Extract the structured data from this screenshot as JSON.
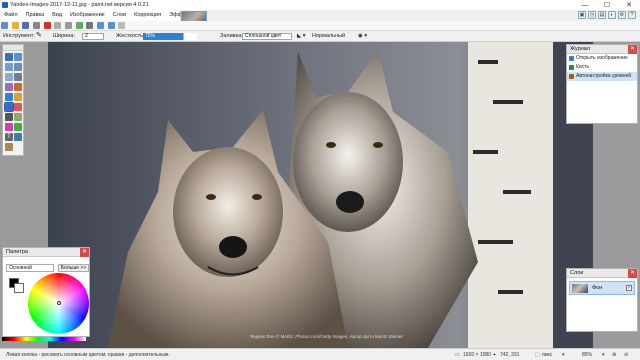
{
  "window": {
    "title": "Yandex-Images-2017-12-11.jpg - paint.net версия 4.0.21",
    "minimize": "—",
    "maximize": "☐",
    "close": "✕"
  },
  "menu": [
    "Файл",
    "Правка",
    "Вид",
    "Изображение",
    "Слои",
    "Коррекция",
    "Эффекты"
  ],
  "toolbar2": {
    "tool_label": "Инструмент:",
    "width_label": "Ширина:",
    "width_value": "2",
    "hardness_label": "Жесткость:",
    "hardness_value": "75%",
    "hardness": 0.75,
    "fill_label": "Заливка:",
    "fill_value": "Сплошной цвет",
    "blend_value": "Нормальный"
  },
  "history": {
    "title": "Журнал",
    "items": [
      {
        "label": "Открыть изображение",
        "color": "#3b78c4"
      },
      {
        "label": "Кисть",
        "color": "#2b8a3e"
      },
      {
        "label": "Автонастройка уровней",
        "color": "#a05c1c"
      }
    ]
  },
  "layers": {
    "title": "Слои",
    "layer_name": "Фон"
  },
  "palette": {
    "title": "Палитра",
    "mode": "Основной",
    "more_button": "Больше >>"
  },
  "status": {
    "text": "Левая кнопка - рисовать основным цветом, правая - дополнительным.",
    "size": "1920 × 1080",
    "coords": "742, 331",
    "unit": "пикс",
    "zoom": "85%"
  },
  "watermark": "Яндекс.Фон © Moritz, Photos.com/Getty Images. Автор фото Moritz Steiner"
}
